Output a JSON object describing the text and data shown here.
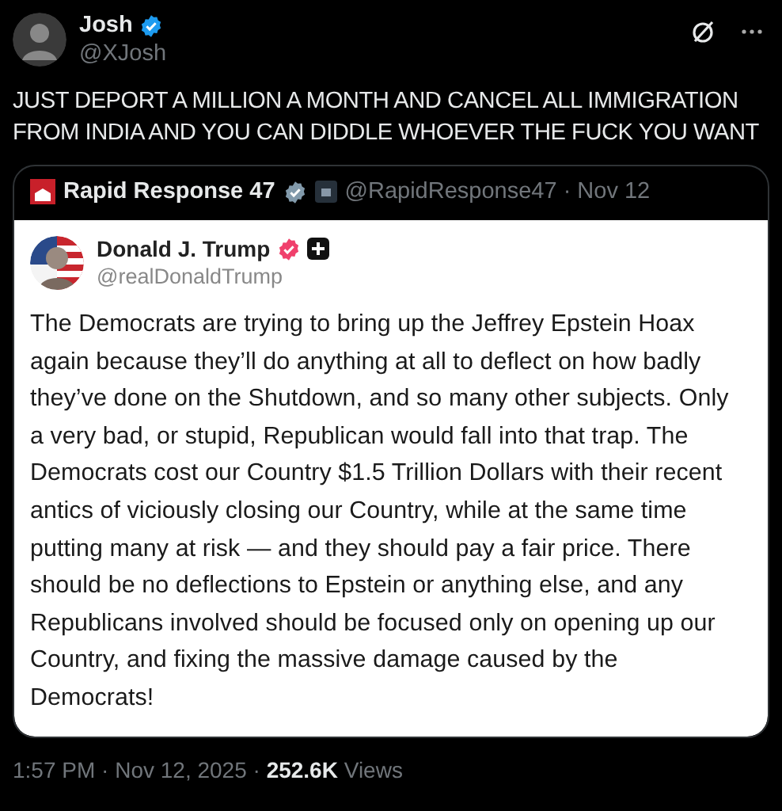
{
  "post": {
    "author": {
      "name": "Josh",
      "handle": "@XJosh",
      "color": "#1d9bf0"
    },
    "text": "JUST DEPORT A MILLION A MONTH AND CANCEL ALL IMMIGRATION FROM INDIA AND YOU CAN DIDDLE WHOEVER THE FUCK YOU WANT",
    "quote": {
      "author": {
        "name": "Rapid Response 47",
        "color": "#829aab"
      },
      "meta": "@RapidResponse47 · Nov 12",
      "embed": {
        "author": {
          "name": "Donald J. Trump",
          "handle": "@realDonaldTrump",
          "color": "#f0406c"
        },
        "text": "The Democrats are trying to bring up the Jeffrey Epstein Hoax again because they’ll do anything at all to deflect on how badly they’ve done on the Shutdown, and so many other subjects. Only a very bad, or stupid, Republican would fall into that trap. The Democrats cost our Country $1.5 Trillion Dollars with their recent antics of viciously closing our Country, while at the same time putting many at risk — and they should pay a fair price. There should be no deflections to Epstein or anything else, and any Republicans involved should be focused only on opening up our Country, and fixing the massive damage caused by the Democrats!"
      }
    },
    "footer": "1:57 PM · Nov 12, 2025 · **252.6K** Views"
  }
}
